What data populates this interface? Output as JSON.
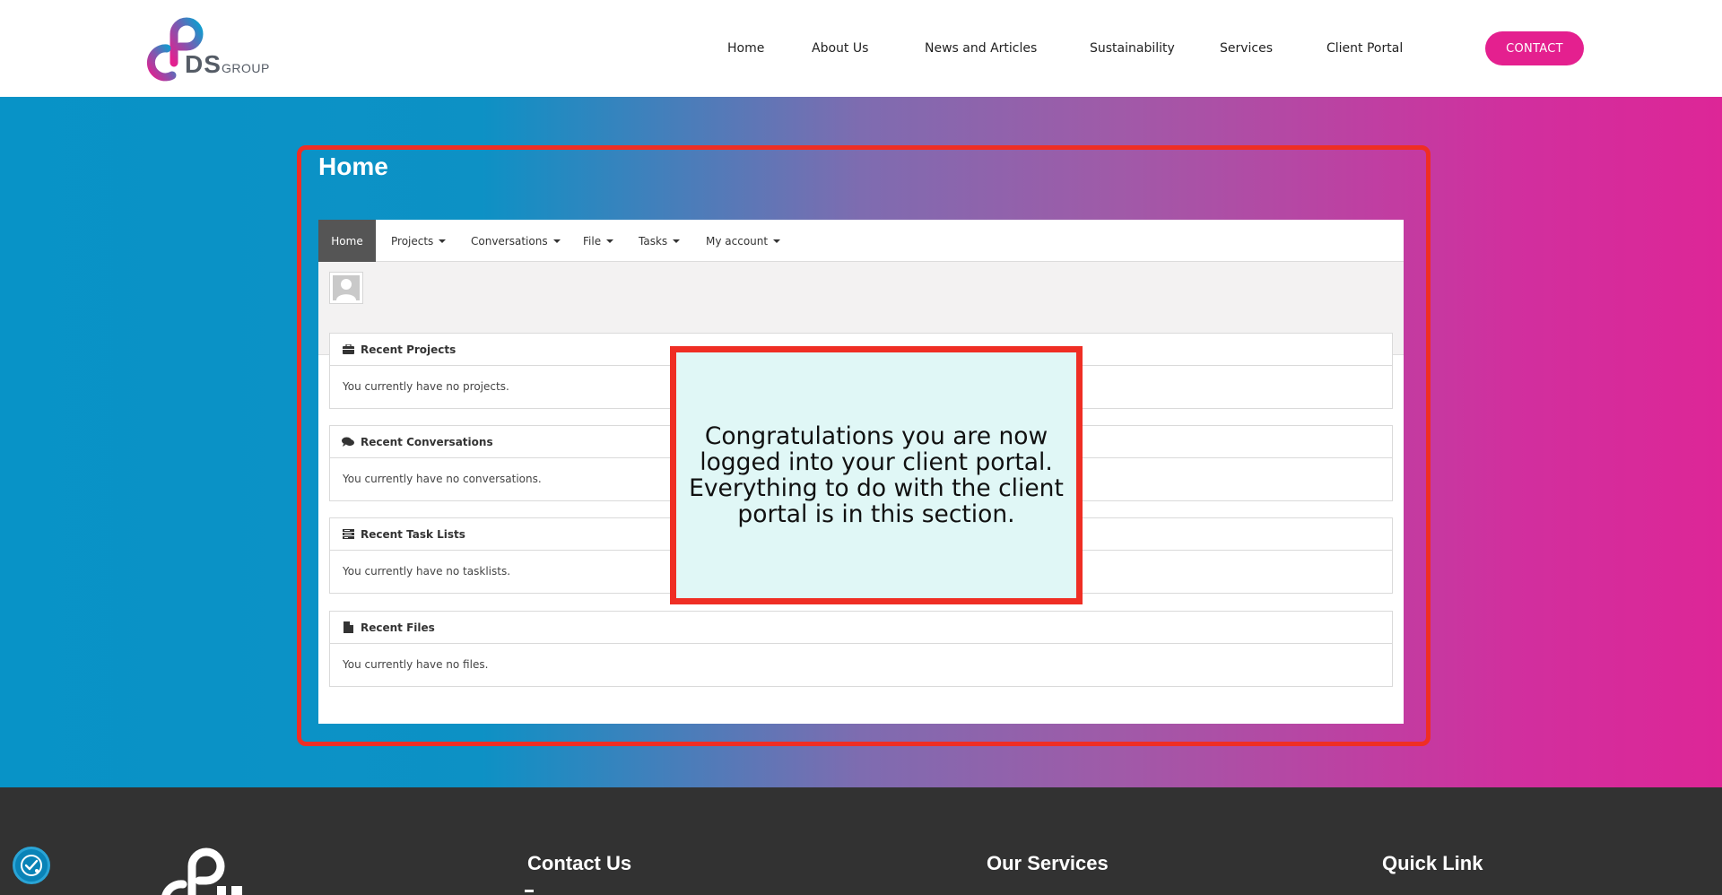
{
  "header": {
    "logo_text": "DS",
    "logo_sub": "GROUP",
    "nav": [
      "Home",
      "About Us",
      "News and Articles",
      "Sustainability",
      "Services",
      "Client Portal"
    ],
    "contact_label": "CONTACT"
  },
  "main": {
    "title": "Home"
  },
  "portal": {
    "nav": [
      "Home",
      "Projects",
      "Conversations",
      "File",
      "Tasks",
      "My account"
    ],
    "panels": [
      {
        "title": "Recent Projects",
        "icon": "briefcase-icon",
        "body": "You currently have no projects."
      },
      {
        "title": "Recent Conversations",
        "icon": "comments-icon",
        "body": "You currently have no conversations."
      },
      {
        "title": "Recent Task Lists",
        "icon": "tasks-icon",
        "body": "You currently have no tasklists."
      },
      {
        "title": "Recent Files",
        "icon": "file-icon",
        "body": "You currently have no files."
      }
    ]
  },
  "callout": {
    "text": "Congratulations you are now logged into your client portal. Everything to do with the client portal is in this section."
  },
  "footer": {
    "headings": [
      "Contact Us",
      "Our Services",
      "Quick Link"
    ]
  },
  "colors": {
    "brand_pink": "#e4208f",
    "brand_blue": "#0893c7",
    "highlight_red": "#ef2e24",
    "footer_bg": "#323232"
  }
}
